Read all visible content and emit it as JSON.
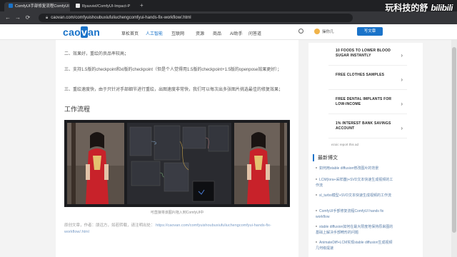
{
  "browser": {
    "tabs": [
      {
        "title": "ComfyUI手部修复流程ComfyUI",
        "active": true
      },
      {
        "title": "lllyasviel/ComfyUI-Impact-P",
        "active": false
      }
    ],
    "url": "caovan.com/comfyuishoubuxiufuliuchengcomfyui-hands-fix-workflow/.html"
  },
  "watermark": {
    "text": "玩科技的舒",
    "brand": "bilibili"
  },
  "site": {
    "logo": "caovan",
    "nav": [
      "草松首页",
      "人工智能",
      "互联网",
      "资源",
      "商品",
      "AI助手",
      "问答道"
    ],
    "user": "操你几",
    "publish": "写文章"
  },
  "article": {
    "paragraphs": [
      "二、效果好，重绘的良品率较高；",
      "三、支持1.5版的checkpoint和xl版的checkpoint（但是个人觉得用1.5版的checkpoint+1.5版的openpose效果更好）；",
      "三、重绘速度快，由于只针对手部细节进行重绘，出图速度非常快，我们可以每次出多张图片挑选最佳的修复效果；"
    ],
    "section_title": "工作流程",
    "caption": "可直接将该图片拖入到ComfyUI中",
    "copyright_text": "原创文章，作者：朋远方，如若转载，请注明出处：",
    "copyright_link": "https://caovan.com/comfyuishoubuxiufuliuchengcomfyui-hands-fix-workflow/.html"
  },
  "sidebar": {
    "ads": [
      "10 FOODS TO LOWER BLOOD SUGAR INSTANTLY",
      "FREE CLOTHES SAMPLES",
      "FREE DENTAL IMPLANTS FOR LOW-INCOME",
      "1% INTEREST BANK SAVINGS ACCOUNT"
    ],
    "ad_footer": "ezoic  report this ad",
    "latest_title": "最新博文",
    "latest": [
      "如何用stable diffusion修改图片的背景",
      "LCM(lora+采样器)+SVD文本快速生成视频的工作流",
      "sl_turbo模型+SVD文本快速生成视频的工作流",
      "ComfyUI手部修复流程ComfyUI hands fix workflow",
      "stable diffusion如何在最大限度地保持原来图的基础上解决手部畸形的问题",
      "AnimateDiff+LCM实现stable diffusion生成视频几何级提速"
    ]
  },
  "colors": {
    "accent": "#1a73c9",
    "chrome": "#35363a"
  }
}
